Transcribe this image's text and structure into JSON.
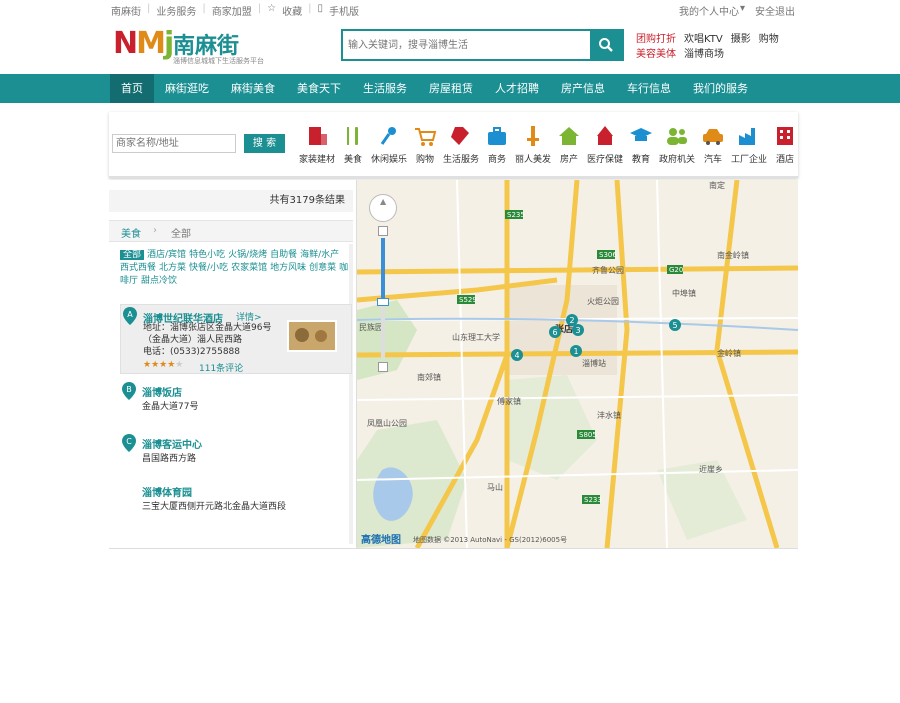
{
  "topbar": {
    "links": [
      "南麻街",
      "业务服务",
      "商家加盟",
      "收藏",
      "手机版"
    ],
    "user": "我的个人中心",
    "logout": "安全退出"
  },
  "logo": {
    "letters": "NMj",
    "name": "南麻街",
    "slogan": "淄博信息城城下生活服务平台"
  },
  "search": {
    "placeholder": "输入关键词，搜寻淄博生活"
  },
  "hotlinks": [
    {
      "text": "团购打折",
      "color": "#c8202c"
    },
    {
      "text": "欢唱KTV",
      "color": "#333333"
    },
    {
      "text": "摄影",
      "color": "#333333"
    },
    {
      "text": "购物",
      "color": "#333333"
    },
    {
      "text": "美容美体",
      "color": "#c8202c"
    },
    {
      "text": "淄博商场",
      "color": "#333333"
    }
  ],
  "nav": [
    "首页",
    "麻街逛吃",
    "麻街美食",
    "美食天下",
    "生活服务",
    "房屋租赁",
    "人才招聘",
    "房产信息",
    "车行信息",
    "我们的服务"
  ],
  "catbar": {
    "search_placeholder": "商家名称/地址",
    "search_button": "搜 索",
    "categories": [
      {
        "label": "家装建材",
        "icon": "building-icon",
        "color": "#c8202c"
      },
      {
        "label": "美食",
        "icon": "fork-knife-icon",
        "color": "#7cb534"
      },
      {
        "label": "休闲娱乐",
        "icon": "microphone-icon",
        "color": "#1b8fd0"
      },
      {
        "label": "购物",
        "icon": "cart-icon",
        "color": "#e08a17"
      },
      {
        "label": "生活服务",
        "icon": "tag-icon",
        "color": "#c8202c"
      },
      {
        "label": "商务",
        "icon": "briefcase-icon",
        "color": "#1b8fd0"
      },
      {
        "label": "丽人美发",
        "icon": "comb-icon",
        "color": "#e08a17"
      },
      {
        "label": "房产",
        "icon": "house-icon",
        "color": "#7cb534"
      },
      {
        "label": "医疗保健",
        "icon": "medical-icon",
        "color": "#c8202c"
      },
      {
        "label": "教育",
        "icon": "graduation-cap-icon",
        "color": "#1b8fd0"
      },
      {
        "label": "政府机关",
        "icon": "people-icon",
        "color": "#7cb534"
      },
      {
        "label": "汽车",
        "icon": "car-icon",
        "color": "#e08a17"
      },
      {
        "label": "工厂企业",
        "icon": "factory-icon",
        "color": "#1b8fd0"
      },
      {
        "label": "酒店",
        "icon": "hotel-icon",
        "color": "#c8202c"
      }
    ]
  },
  "results": {
    "count_text": "共有3179条结果",
    "crumb": [
      "美食",
      "全部"
    ],
    "filters": [
      "全部",
      "酒店/宾馆",
      "特色小吃",
      "火锅/烧烤",
      "自助餐",
      "海鲜/水产",
      "西式西餐",
      "北方菜",
      "快餐/小吃",
      "农家菜馆",
      "地方风味",
      "创意菜",
      "咖啡厅",
      "甜点冷饮"
    ],
    "items": [
      {
        "letter": "A",
        "title": "淄博世纪联华酒店",
        "detail": "详情>",
        "address": "地址：淄博张店区金晶大道96号",
        "address2": "（金晶大道）淄人民西路",
        "phone": "电话：(0533)2755888",
        "reviews": "111条评论",
        "stars": 4
      },
      {
        "letter": "B",
        "title": "淄博饭店",
        "address": "金晶大道77号"
      },
      {
        "letter": "C",
        "title": "淄博客运中心",
        "address": "昌国路西方路"
      },
      {
        "letter": "D",
        "title": "淄博体育园",
        "address": "三宝大厦西侧开元路北金晶大道西段"
      }
    ]
  },
  "map": {
    "labels": [
      "南金岭镇",
      "齐鲁公园",
      "中埠镇",
      "南定",
      "山东理工大学",
      "火炬公园",
      "张店",
      "淄博站",
      "南郊镇",
      "傅家镇",
      "沣水镇",
      "凤凰山公园",
      "马山",
      "金岭镇",
      "近崖乡",
      "民族园",
      "高德地图",
      "地图数据 ©2013 AutoNavi - GS(2012)6005号"
    ],
    "roads": [
      "S235",
      "G20",
      "S306",
      "S310",
      "S529",
      "S805",
      "S233",
      "S102",
      "S303",
      "S223",
      "S301"
    ],
    "markers": [
      "1",
      "2",
      "3",
      "4",
      "5",
      "6"
    ]
  }
}
